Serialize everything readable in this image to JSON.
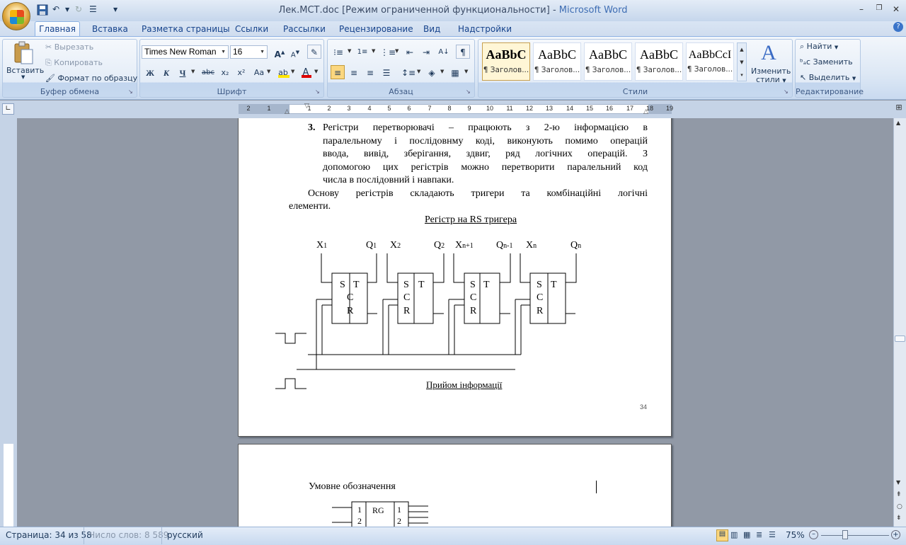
{
  "window": {
    "title_doc": "Лек.МСТ.doc [Режим ограниченной функциональности]",
    "title_sep": " - ",
    "title_app": "Microsoft Word"
  },
  "tabs": [
    "Главная",
    "Вставка",
    "Разметка страницы",
    "Ссылки",
    "Рассылки",
    "Рецензирование",
    "Вид",
    "Надстройки"
  ],
  "ribbon": {
    "clipboard": {
      "label": "Буфер обмена",
      "paste": "Вставить",
      "cut": "Вырезать",
      "copy": "Копировать",
      "format_painter": "Формат по образцу"
    },
    "font": {
      "label": "Шрифт",
      "font_name": "Times New Roman",
      "font_size": "16",
      "bold": "Ж",
      "italic": "К",
      "underline": "Ч",
      "strike": "abc",
      "subscript": "x₂",
      "superscript": "x²",
      "case": "Aa"
    },
    "paragraph": {
      "label": "Абзац"
    },
    "styles": {
      "label": "Стили",
      "items": [
        {
          "sample": "AaBbC",
          "name": "¶ Заголов..."
        },
        {
          "sample": "AaBbC",
          "name": "¶ Заголов..."
        },
        {
          "sample": "AaBbC",
          "name": "¶ Заголов..."
        },
        {
          "sample": "AaBbC",
          "name": "¶ Заголов..."
        },
        {
          "sample": "AaBbCcI",
          "name": "¶ Заголов..."
        }
      ],
      "change_styles_1": "Изменить",
      "change_styles_2": "стили"
    },
    "editing": {
      "label": "Редактирование",
      "find": "Найти",
      "replace": "Заменить",
      "select": "Выделить"
    }
  },
  "ruler": {
    "numbers": [
      "2",
      "1",
      "1",
      "2",
      "3",
      "4",
      "5",
      "6",
      "7",
      "8",
      "9",
      "10",
      "11",
      "12",
      "13",
      "14",
      "15",
      "16",
      "17",
      "18",
      "19"
    ]
  },
  "document": {
    "item_number": "3.",
    "item_lines": [
      "Регістри перетворювачі – працюють з 2-ю інформацією в",
      "паралельному і послідовнму коді, виконують помимо операцій",
      "ввода, вивід, зберігання, здвиг, ряд логічних операцій. З",
      "допомогою цих регістрів можно перетворити паралельний код",
      "числа в послідовний і навпаки."
    ],
    "para_line1": "Основу регістрів складають тригери та комбінаційні логічні",
    "para_line2": "елементи.",
    "diagram_title": "Регістр на RS тригера",
    "diagram_caption": "Прийом інформації",
    "page_number": "34",
    "labels": {
      "x1": "X",
      "x1s": "1",
      "q1": "Q",
      "q1s": "1",
      "x2": "X",
      "x2s": "2",
      "q2": "Q",
      "q2s": "2",
      "xn1": "X",
      "xn1s": "n+1",
      "qn1": "Q",
      "qn1s": "n-1",
      "xn": "X",
      "xns": "n",
      "qn": "Q",
      "qns": "n",
      "s": "S",
      "t": "T",
      "c": "C",
      "r": "R"
    },
    "page2_heading": "Умовне обозначення",
    "rg_label": "RG",
    "rg_in1": "1",
    "rg_in2": "2",
    "rg_out1": "1",
    "rg_out2": "2"
  },
  "status": {
    "page": "Страница: 34 из 58",
    "words": "Число слов: 8 589",
    "language": "русский",
    "zoom": "75%"
  }
}
